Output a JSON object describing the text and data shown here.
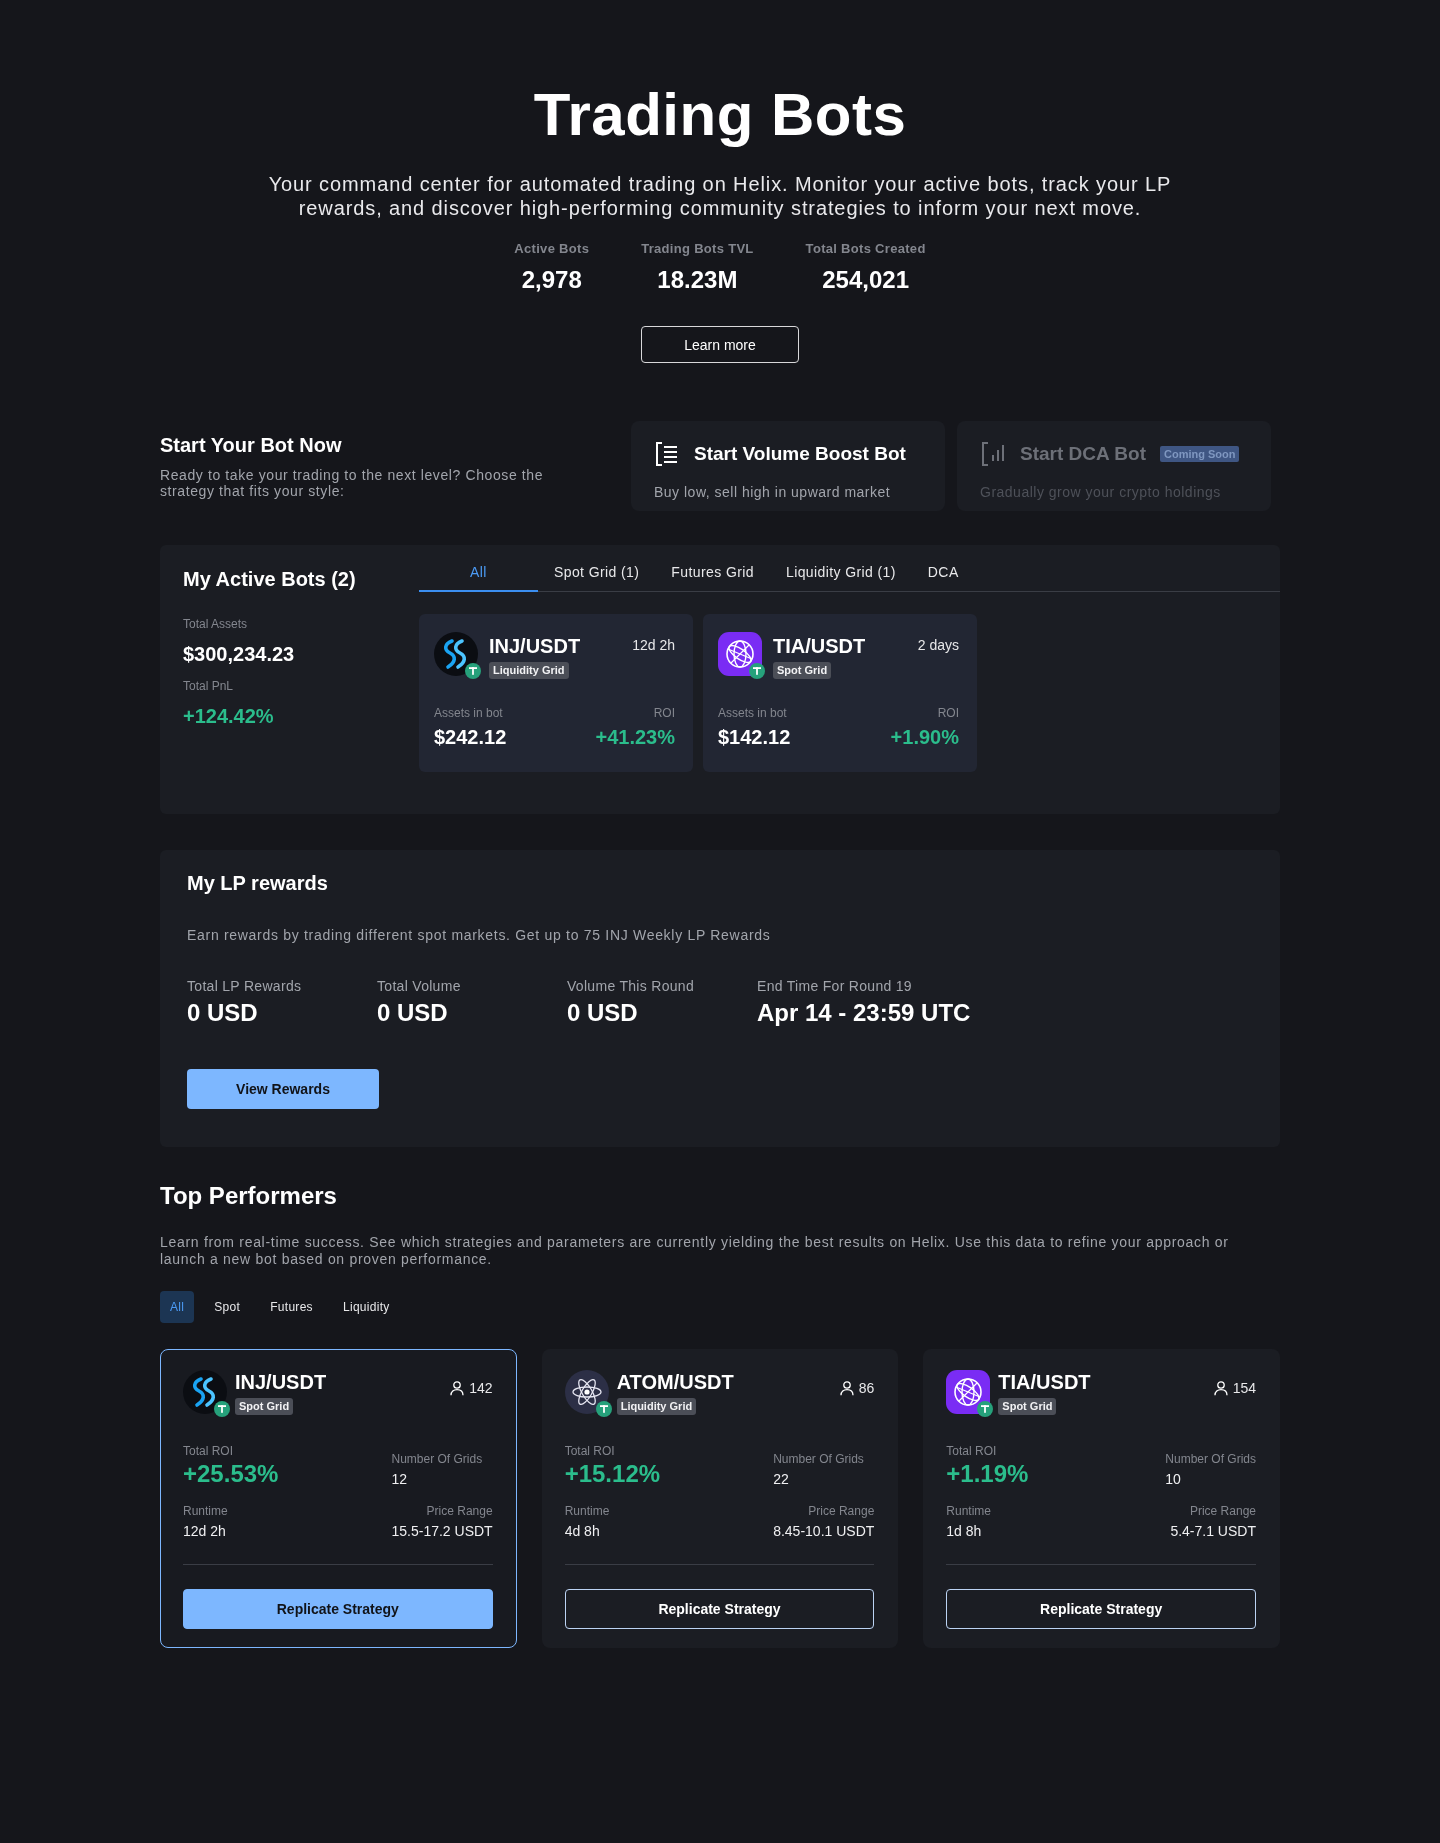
{
  "header": {
    "title": "Trading Bots",
    "subtitle": "Your command center for automated trading on Helix. Monitor your active bots, track your LP rewards, and discover high-performing community strategies to inform your next move.",
    "stats": [
      {
        "label": "Active Bots",
        "value": "2,978"
      },
      {
        "label": "Trading Bots TVL",
        "value": "18.23M"
      },
      {
        "label": "Total Bots Created",
        "value": "254,021"
      }
    ],
    "learn_more_button": "Learn more"
  },
  "start_bot": {
    "title": "Start Your Bot Now",
    "description": "Ready to take your trading to the next level? Choose the strategy that fits your style:",
    "options": [
      {
        "kind": "list",
        "title": "Start Volume Boost Bot",
        "description": "Buy low, sell high in upward market",
        "disabled": false
      },
      {
        "kind": "chart",
        "title": "Start DCA Bot",
        "badge": "Coming Soon",
        "description": "Gradually grow your crypto holdings",
        "disabled": true
      }
    ]
  },
  "active_bots": {
    "title": "My Active Bots (2)",
    "total_assets_label": "Total Assets",
    "total_assets": "$300,234.23",
    "total_pnl_label": "Total PnL",
    "total_pnl": "+124.42%",
    "tabs": [
      {
        "label": "All",
        "selected": true
      },
      {
        "label": "Spot Grid (1)",
        "selected": false
      },
      {
        "label": "Futures Grid",
        "selected": false
      },
      {
        "label": "Liquidity Grid (1)",
        "selected": false
      },
      {
        "label": "DCA",
        "selected": false
      }
    ],
    "bots": [
      {
        "kind": "waves",
        "pair": "INJ/USDT",
        "strategy": "Liquidity Grid",
        "runtime": "12d 2h",
        "assets_label": "Assets in bot",
        "assets": "$242.12",
        "roi_label": "ROI",
        "roi": "+41.23%"
      },
      {
        "kind": "globe",
        "pair": "TIA/USDT",
        "strategy": "Spot Grid",
        "runtime": "2 days",
        "assets_label": "Assets in bot",
        "assets": "$142.12",
        "roi_label": "ROI",
        "roi": "+1.90%"
      }
    ]
  },
  "lp_rewards": {
    "title": "My LP rewards",
    "description": "Earn rewards by trading different spot markets. Get up to 75 INJ Weekly LP Rewards",
    "stats": [
      {
        "label": "Total LP Rewards",
        "value": "0 USD"
      },
      {
        "label": "Total Volume",
        "value": "0 USD"
      },
      {
        "label": "Volume This Round",
        "value": "0 USD"
      },
      {
        "label": "End Time For Round 19",
        "value": "Apr 14 - 23:59 UTC"
      }
    ],
    "button": "View Rewards"
  },
  "top_performers": {
    "title": "Top Performers",
    "description": "Learn from real-time success. See which strategies and parameters are currently yielding the best results on Helix. Use this data to refine your approach or launch a new bot based on proven performance.",
    "filters": [
      {
        "label": "All",
        "selected": true
      },
      {
        "label": "Spot",
        "selected": false
      },
      {
        "label": "Futures",
        "selected": false
      },
      {
        "label": "Liquidity",
        "selected": false
      }
    ],
    "cards": [
      {
        "kind": "waves",
        "pair": "INJ/USDT",
        "strategy": "Spot Grid",
        "users": "142",
        "roi_label": "Total ROI",
        "roi": "+25.53%",
        "grids_label": "Number Of Grids",
        "grids": "12",
        "runtime_label": "Runtime",
        "runtime": "12d 2h",
        "range_label": "Price Range",
        "range": "15.5-17.2 USDT",
        "button": "Replicate Strategy",
        "selected": true
      },
      {
        "kind": "atom",
        "pair": "ATOM/USDT",
        "strategy": "Liquidity Grid",
        "users": "86",
        "roi_label": "Total ROI",
        "roi": "+15.12%",
        "grids_label": "Number Of Grids",
        "grids": "22",
        "runtime_label": "Runtime",
        "runtime": "4d 8h",
        "range_label": "Price Range",
        "range": "8.45-10.1 USDT",
        "button": "Replicate Strategy",
        "selected": false
      },
      {
        "kind": "globe",
        "pair": "TIA/USDT",
        "strategy": "Spot Grid",
        "users": "154",
        "roi_label": "Total ROI",
        "roi": "+1.19%",
        "grids_label": "Number Of Grids",
        "grids": "10",
        "runtime_label": "Runtime",
        "runtime": "1d 8h",
        "range_label": "Price Range",
        "range": "5.4-7.1 USDT",
        "button": "Replicate Strategy",
        "selected": false
      }
    ]
  }
}
